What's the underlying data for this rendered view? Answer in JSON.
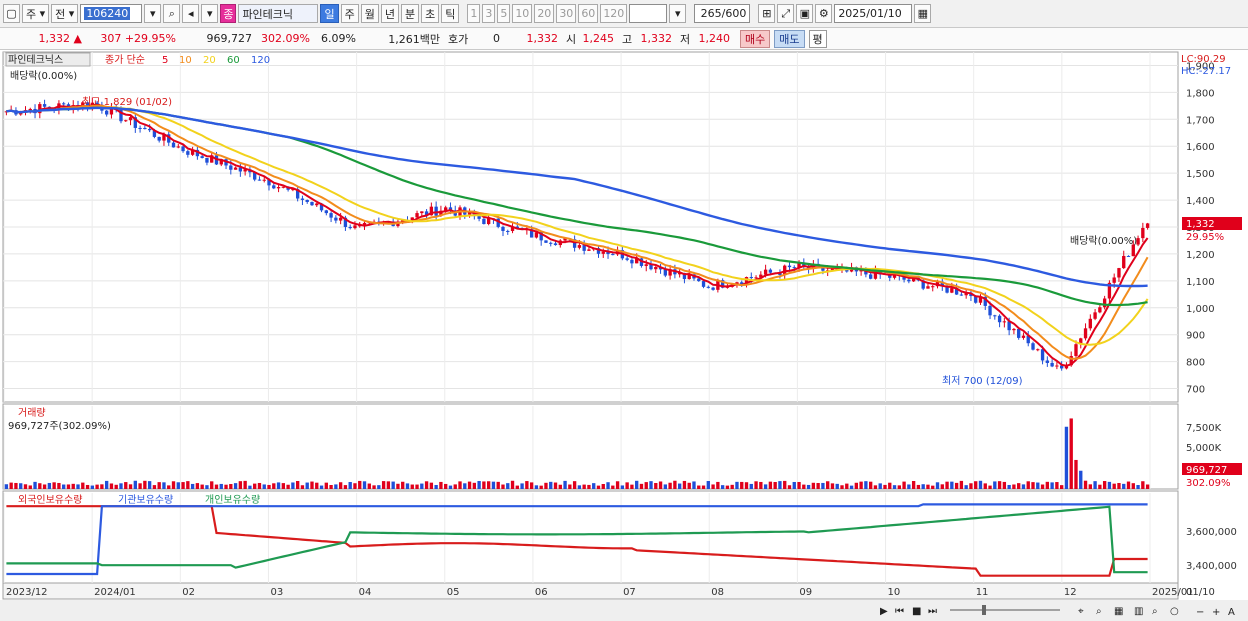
{
  "toolbar": {
    "market": "주",
    "prev": "전",
    "code": "106240",
    "name": "파인테크닉",
    "name_tag": "종",
    "periods": [
      "일",
      "주",
      "월",
      "년",
      "분",
      "초",
      "틱"
    ],
    "active_period": "일",
    "intervals": [
      "1",
      "3",
      "5",
      "10",
      "20",
      "30",
      "60",
      "120"
    ],
    "count": "265",
    "count_max": "/600",
    "date": "2025/01/10"
  },
  "quote": {
    "price": "1,332",
    "change": "307",
    "change_pct": "+29.95%",
    "volume": "969,727",
    "volume_ratio": "302.09%",
    "turnover_pct": "6.09%",
    "amount": "1,261백만",
    "hoga_label": "호가",
    "hoga_value": "0",
    "bid": "1,332",
    "open_label": "시",
    "open": "1,245",
    "high_label": "고",
    "high": "1,332",
    "low_label": "저",
    "low": "1,240",
    "buy_label": "매수",
    "sell_label": "매도",
    "p_label": "평"
  },
  "legend": {
    "name": "파인테크닉스",
    "indicator": "종가 단순",
    "mas": [
      {
        "period": "5",
        "color": "#e0001b"
      },
      {
        "period": "10",
        "color": "#f28c1c"
      },
      {
        "period": "20",
        "color": "#f2d21c"
      },
      {
        "period": "60",
        "color": "#1a9a3a"
      },
      {
        "period": "120",
        "color": "#2d5ae0"
      }
    ],
    "event": "배당락(0.00%)"
  },
  "chart_data": [
    {
      "type": "candlestick",
      "title": "파인테크닉스 종가 단순 5 10 20 60 120",
      "x_labels": [
        "2023/12",
        "2024/01",
        "02",
        "03",
        "04",
        "05",
        "06",
        "07",
        "08",
        "09",
        "10",
        "11",
        "12",
        "2025/01"
      ],
      "y_ticks": [
        "1,900",
        "1,800",
        "1,700",
        "1,600",
        "1,500",
        "1,400",
        "1,300",
        "1,200",
        "1,100",
        "1,000",
        "900",
        "800",
        "700"
      ],
      "ylim": [
        650,
        1950
      ],
      "close_monthly": [
        1730,
        1760,
        1590,
        1470,
        1290,
        1370,
        1270,
        1200,
        1080,
        1150,
        1120,
        1050,
        760,
        1332
      ],
      "last_price": "1,332",
      "last_change_pct": "29.95%",
      "annotations": [
        "최고 1,829 (01/02)",
        "최저 700 (12/09)",
        "배당락(0.00%)"
      ],
      "top_right": [
        "LC:90.29",
        "HC:-27.17"
      ]
    },
    {
      "type": "bar",
      "title": "거래량",
      "value_label": "969,727주(302.09%)",
      "y_ticks": [
        "7,500K",
        "5,000K"
      ],
      "last_value": "969,727",
      "last_ratio": "302.09%"
    },
    {
      "type": "line",
      "series": [
        {
          "name": "외국인보유수량",
          "color": "#d81c1c"
        },
        {
          "name": "기관보유수량",
          "color": "#2d5ae0"
        },
        {
          "name": "개인보유수량",
          "color": "#1f9a52"
        }
      ],
      "y_ticks": [
        "3,600,000",
        "3,400,000"
      ]
    }
  ],
  "axis_bottom_right": "01/10",
  "colors": {
    "up": "#e0001b",
    "down": "#1f4fd8",
    "accent": "#3d7be0"
  }
}
